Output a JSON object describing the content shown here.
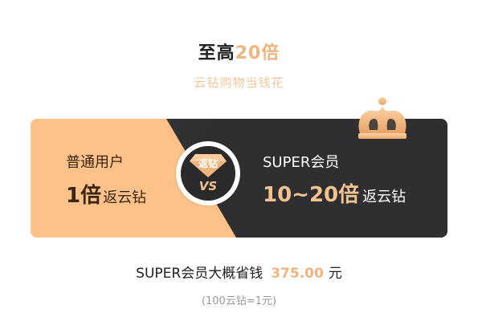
{
  "header": {
    "title_prefix": "至高",
    "title_highlight": "20倍",
    "subtitle": "云钻购物当钱花"
  },
  "comparison": {
    "normal": {
      "label": "普通用户",
      "rate": "1倍",
      "rate_suffix": "返云钻"
    },
    "badge": {
      "gem_label": "返钻",
      "vs_label": "VS"
    },
    "super": {
      "label": "SUPER会员",
      "rate": "10~20倍",
      "rate_suffix": "返云钻"
    },
    "crown_icon": "crown-icon"
  },
  "savings": {
    "prefix": "SUPER会员大概省钱",
    "amount": "375.00",
    "unit": "元"
  },
  "note": "(100云钻=1元)",
  "colors": {
    "accent": "#f0b47c",
    "normal_card": "#fcc28a",
    "super_card": "#2f2f31",
    "text_dark": "#222222",
    "muted": "#9a9a9a"
  }
}
